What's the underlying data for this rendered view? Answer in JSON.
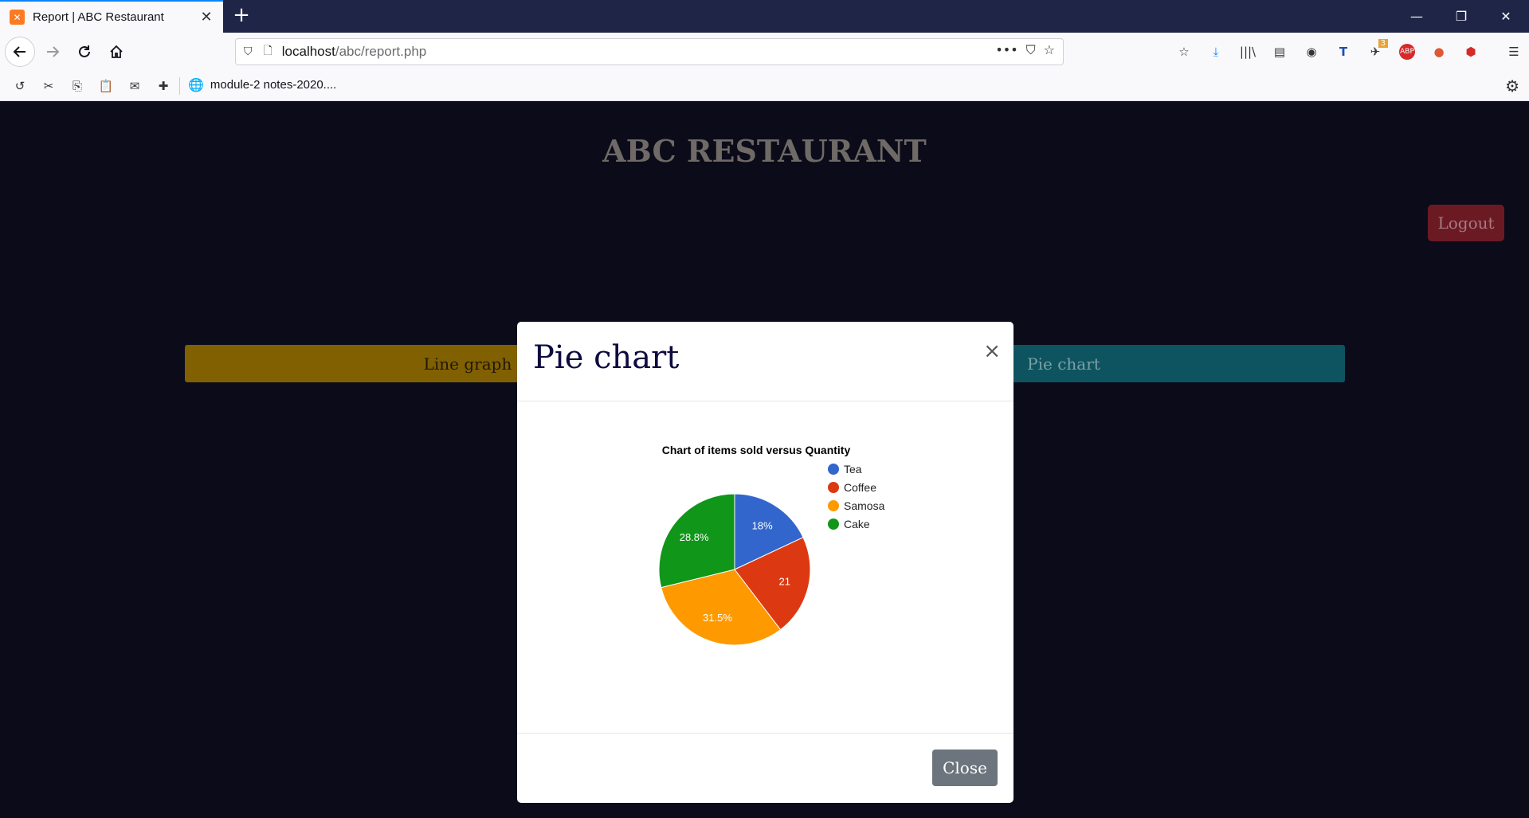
{
  "browser": {
    "tab_title": "Report | ABC Restaurant",
    "url_host": "localhost",
    "url_path": "/abc/report.php",
    "bookmark_label": "module-2 notes-2020....",
    "download_badge": "3",
    "icons": {
      "abp": "ABP"
    }
  },
  "page": {
    "brand": "ABC RESTAURANT",
    "logout_label": "Logout",
    "line_graph_label": "Line graph",
    "pie_chart_label": "Pie chart"
  },
  "modal": {
    "title": "Pie chart",
    "close_x": "×",
    "close_label": "Close"
  },
  "chart_data": {
    "type": "pie",
    "title": "Chart of items sold versus Quantity",
    "categories": [
      "Tea",
      "Coffee",
      "Samosa",
      "Cake"
    ],
    "values": [
      18,
      21.6,
      31.5,
      28.8
    ],
    "labels": [
      "18%",
      "21",
      "31.5%",
      "28.8%"
    ],
    "colors": [
      "#3366cc",
      "#dc3912",
      "#ff9900",
      "#109618"
    ],
    "legend_position": "right"
  }
}
